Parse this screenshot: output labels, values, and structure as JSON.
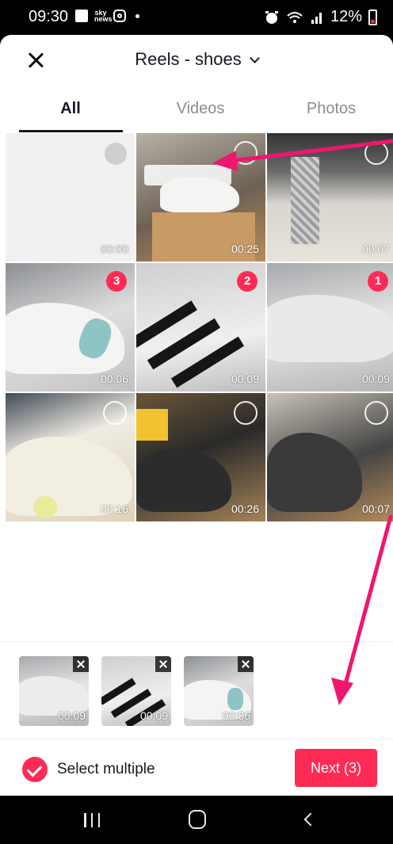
{
  "status_bar": {
    "time": "09:30",
    "battery": "12%"
  },
  "header": {
    "album_title": "Reels -  shoes"
  },
  "tabs": [
    {
      "label": "All",
      "active": true
    },
    {
      "label": "Videos",
      "active": false
    },
    {
      "label": "Photos",
      "active": false
    }
  ],
  "grid": {
    "items": [
      {
        "duration": "00:00",
        "selection": "",
        "state": "empty"
      },
      {
        "duration": "00:25",
        "selection": "",
        "state": "unselected"
      },
      {
        "duration": "00:07",
        "selection": "",
        "state": "unselected"
      },
      {
        "duration": "00:06",
        "selection": "3",
        "state": "selected"
      },
      {
        "duration": "00:09",
        "selection": "2",
        "state": "selected"
      },
      {
        "duration": "00:09",
        "selection": "1",
        "state": "selected"
      },
      {
        "duration": "00:16",
        "selection": "",
        "state": "unselected"
      },
      {
        "duration": "00:26",
        "selection": "",
        "state": "unselected"
      },
      {
        "duration": "00:07",
        "selection": "",
        "state": "unselected"
      }
    ]
  },
  "selected_tray": {
    "items": [
      {
        "duration": "00:09"
      },
      {
        "duration": "00:09"
      },
      {
        "duration": "00:06"
      }
    ]
  },
  "footer": {
    "select_multiple_label": "Select multiple",
    "next_label": "Next (3)"
  },
  "colors": {
    "accent": "#fe2c55",
    "annotation_arrow": "#f0166d"
  }
}
